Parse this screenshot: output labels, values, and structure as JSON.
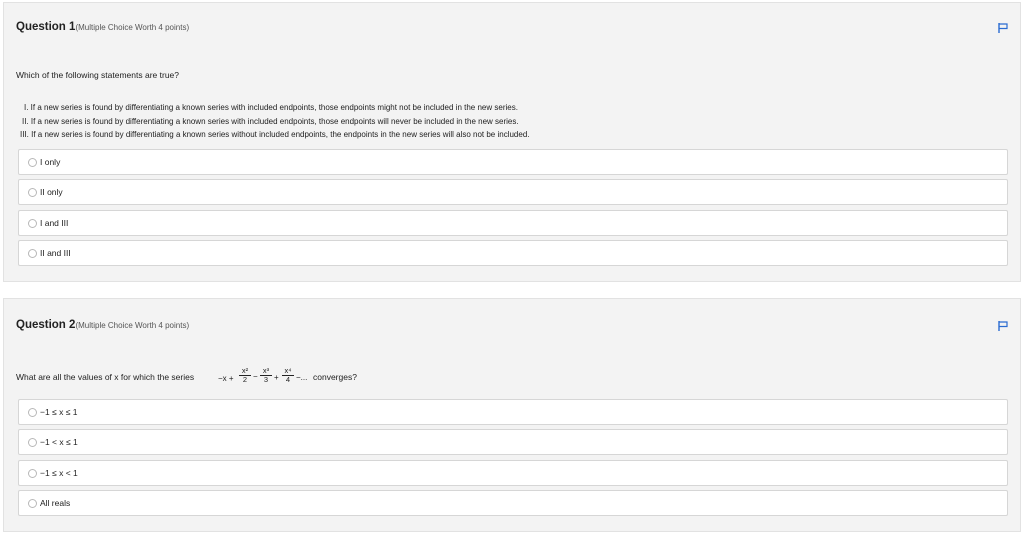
{
  "q1": {
    "title": "Question 1",
    "subtitle": "(Multiple Choice Worth 4 points)",
    "prompt": "Which of the following statements are true?",
    "statements": [
      "I. If a new series is found by differentiating a known series with included endpoints, those endpoints might not be included in the new series.",
      "II. If a new series is found by differentiating a known series with included endpoints, those endpoints will never be included in the new series.",
      "III. If a new series is found by differentiating a known series without included endpoints, the endpoints in the new series will also not be included."
    ],
    "options": [
      "I only",
      "II only",
      "I and III",
      "II and III"
    ]
  },
  "q2": {
    "title": "Question 2",
    "subtitle": "(Multiple Choice Worth 4 points)",
    "prompt_before": "What are all the values of x for which the series",
    "prompt_after": "converges?",
    "series": {
      "lead": "−x +",
      "t2_num": "x²",
      "t2_den": "2",
      "op2": "−",
      "t3_num": "x³",
      "t3_den": "3",
      "op3": "+",
      "t4_num": "x⁴",
      "t4_den": "4",
      "tail": "−..."
    },
    "options": [
      "−1 ≤ x ≤ 1",
      "−1 < x ≤ 1",
      "−1 ≤ x < 1",
      "All reals"
    ]
  },
  "colors": {
    "flag": "#2a6bd1",
    "card_bg": "#f3f3f3",
    "option_border": "#d6d6d6"
  },
  "icons": {
    "flag": "flag-icon",
    "radio": "radio-circle"
  }
}
